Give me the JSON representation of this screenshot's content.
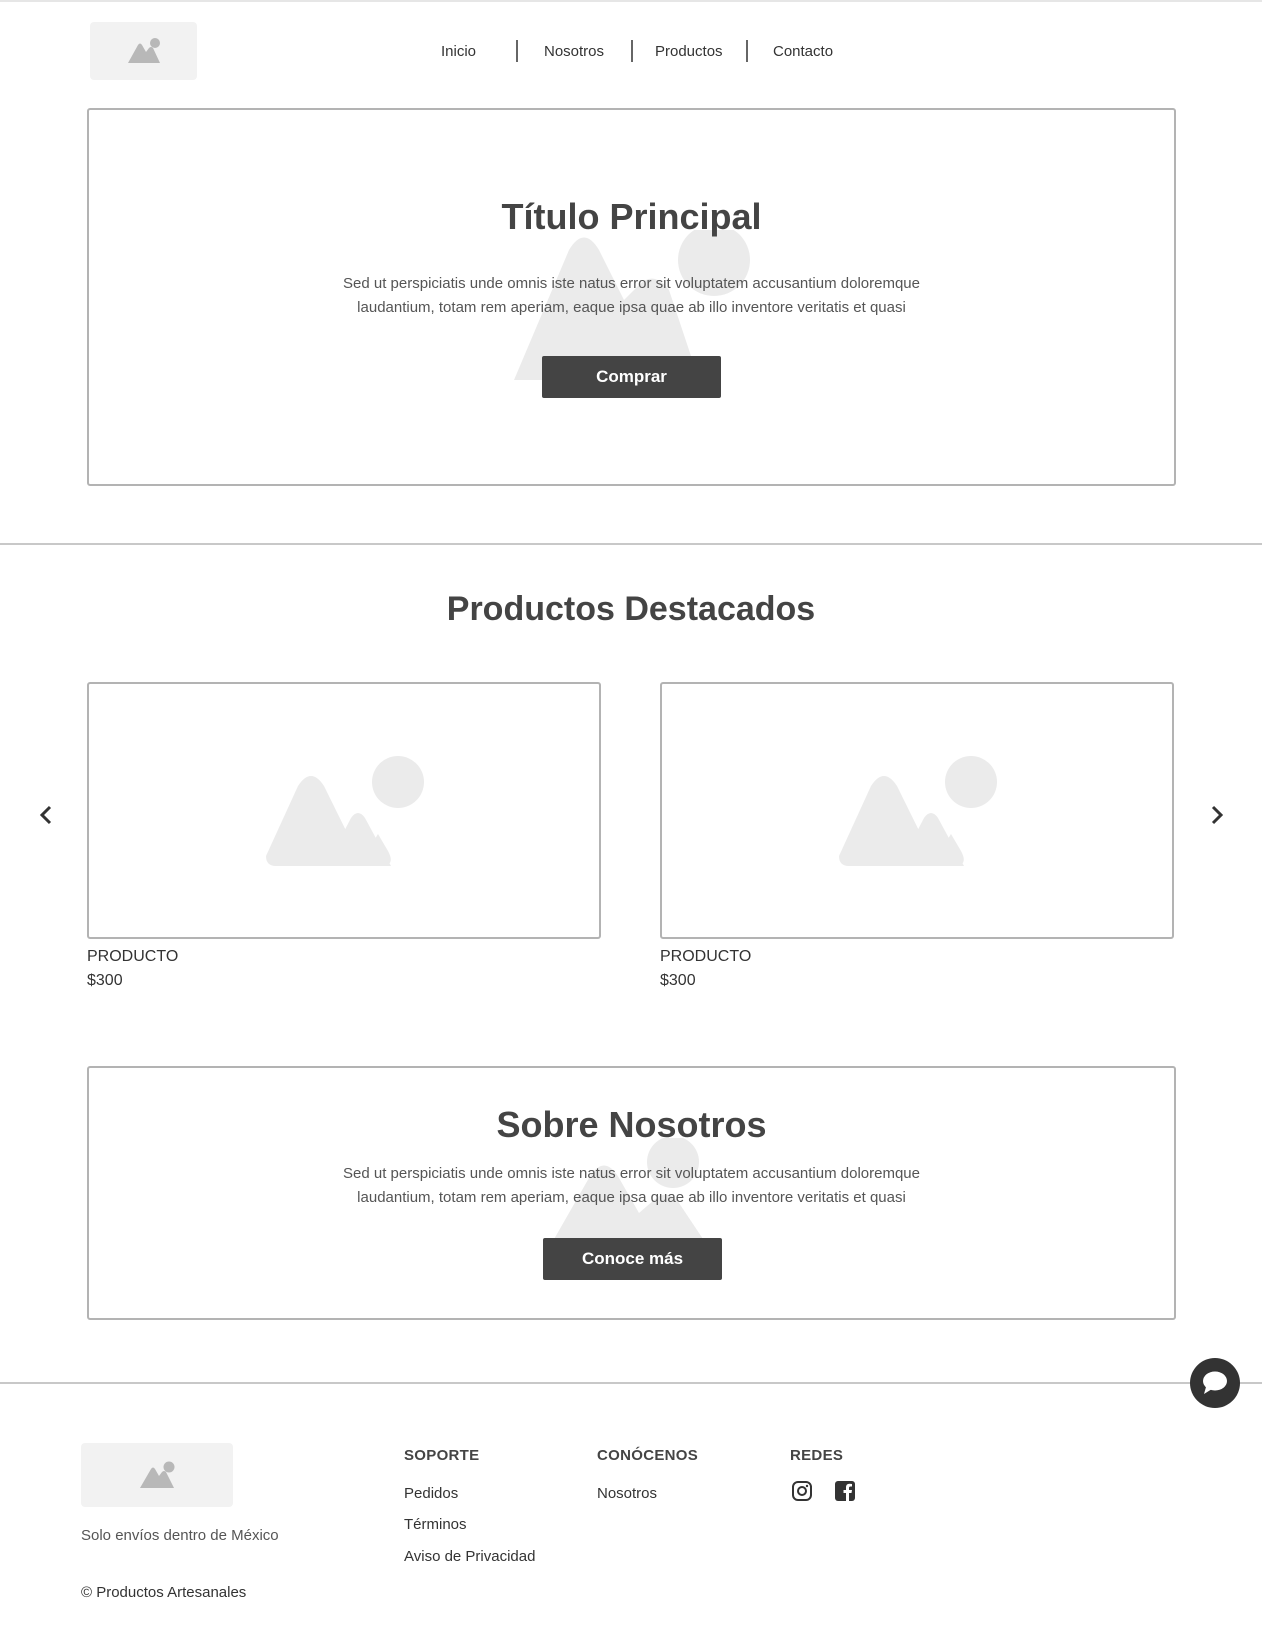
{
  "header": {
    "logo_icon": "image-placeholder-icon",
    "nav": [
      {
        "label": "Inicio"
      },
      {
        "label": "Nosotros"
      },
      {
        "label": "Productos"
      },
      {
        "label": "Contacto"
      }
    ]
  },
  "hero": {
    "title": "Título Principal",
    "text": "Sed ut perspiciatis unde omnis iste natus error sit voluptatem accusantium doloremque laudantium, totam rem aperiam, eaque ipsa quae ab illo inventore veritatis et quasi",
    "button": "Comprar",
    "bg_icon": "image-placeholder-icon"
  },
  "featured": {
    "title": "Productos Destacados",
    "prev_icon": "chevron-left-icon",
    "next_icon": "chevron-right-icon",
    "products": [
      {
        "name": "PRODUCTO",
        "price": "$300"
      },
      {
        "name": "PRODUCTO",
        "price": "$300"
      }
    ]
  },
  "about": {
    "title": "Sobre Nosotros",
    "text": "Sed ut perspiciatis unde omnis iste natus error sit voluptatem accusantium doloremque laudantium, totam rem aperiam, eaque ipsa quae ab illo inventore veritatis et quasi",
    "button": "Conoce más"
  },
  "chat_icon": "chat-bubble-icon",
  "footer": {
    "note": "Solo envíos dentro de México",
    "copyright": "© Productos Artesanales",
    "columns": [
      {
        "heading": "SOPORTE",
        "links": [
          "Pedidos",
          "Términos",
          "Aviso de Privacidad"
        ]
      },
      {
        "heading": "CONÓCENOS",
        "links": [
          "Nosotros"
        ]
      },
      {
        "heading": "REDES",
        "icons": [
          "instagram-icon",
          "facebook-icon"
        ]
      }
    ]
  },
  "colors": {
    "dark": "#444444",
    "border": "#b3b3b3",
    "placeholder": "#e8e8e8"
  }
}
